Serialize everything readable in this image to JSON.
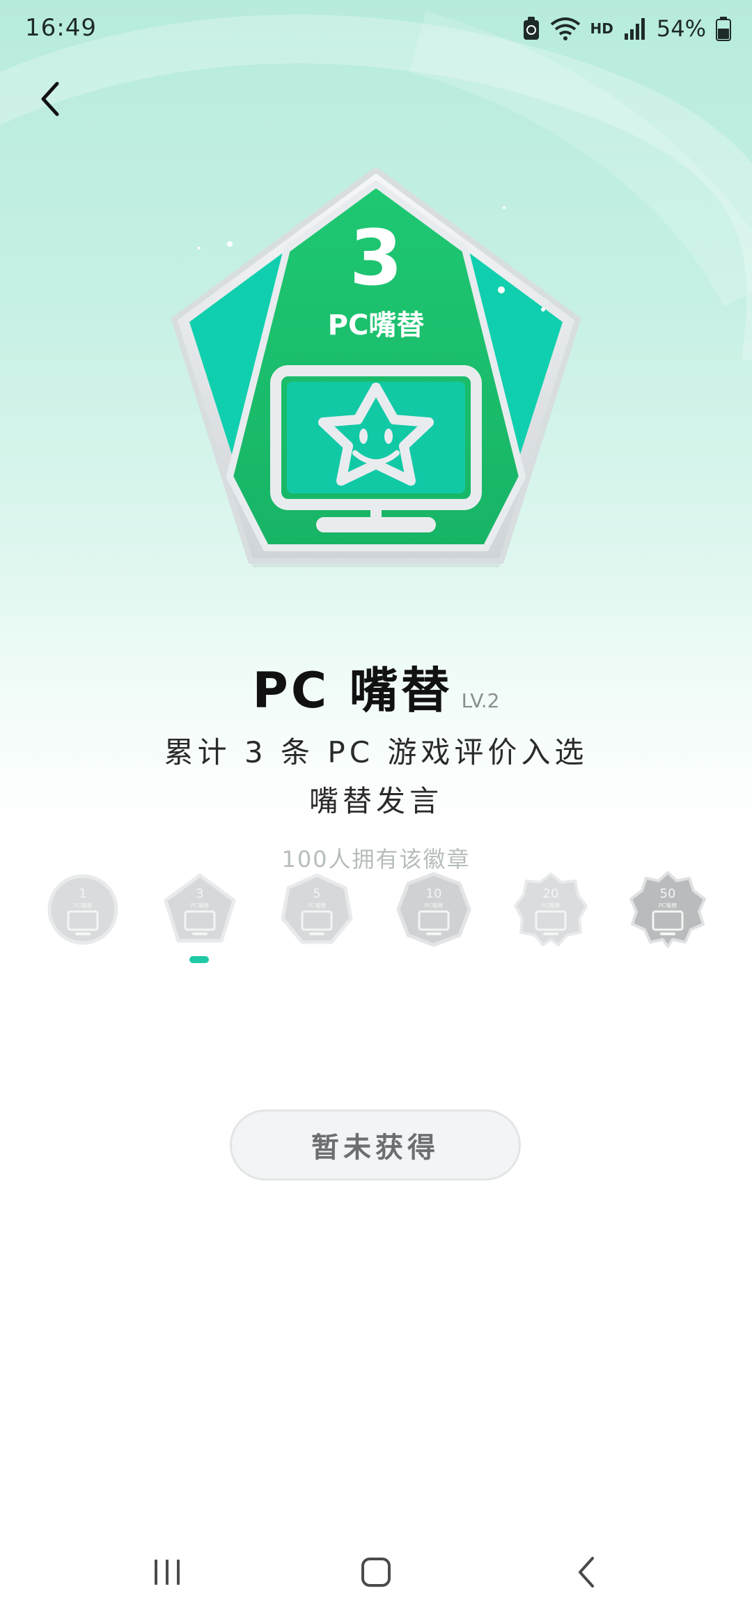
{
  "status_bar": {
    "time": "16:49",
    "network": "HD",
    "battery": "54%"
  },
  "badge": {
    "count": "3",
    "name_on_badge": "PC嘴替",
    "colors": {
      "primary": "#1dbf6d",
      "panel": "#0fcca8",
      "rim": "#e3e7ea"
    }
  },
  "title": "PC 嘴替",
  "level": "LV.2",
  "description": "累计 3 条 PC 游戏评价入选嘴替发言",
  "owners": "100人拥有该徽章",
  "level_badges": [
    {
      "count": "1",
      "label": "PC嘴替"
    },
    {
      "count": "3",
      "label": "PC嘴替",
      "selected": true
    },
    {
      "count": "5",
      "label": "PC嘴替"
    },
    {
      "count": "10",
      "label": "PC嘴替"
    },
    {
      "count": "20",
      "label": "PC嘴替"
    },
    {
      "count": "50",
      "label": "PC嘴替"
    }
  ],
  "action_button": "暂未获得",
  "icons": {
    "back": "chevron-left-icon",
    "recents": "recent-apps-icon",
    "home": "home-icon",
    "nav_back": "nav-back-icon"
  }
}
